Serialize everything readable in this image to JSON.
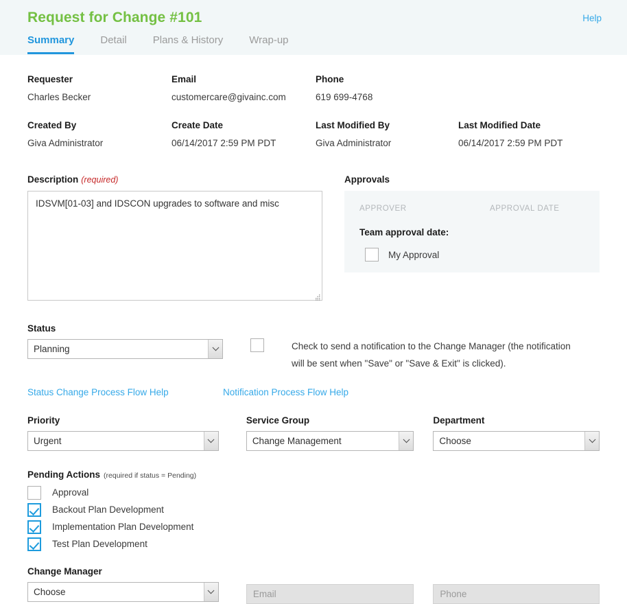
{
  "header": {
    "title": "Request for Change #101",
    "help_label": "Help",
    "tabs": [
      {
        "label": "Summary",
        "active": true
      },
      {
        "label": "Detail",
        "active": false
      },
      {
        "label": "Plans & History",
        "active": false
      },
      {
        "label": "Wrap-up",
        "active": false
      }
    ]
  },
  "info": {
    "requester_label": "Requester",
    "requester_value": "Charles Becker",
    "email_label": "Email",
    "email_value": "customercare@givainc.com",
    "phone_label": "Phone",
    "phone_value": "619 699-4768",
    "created_by_label": "Created By",
    "created_by_value": "Giva Administrator",
    "create_date_label": "Create Date",
    "create_date_value": "06/14/2017 2:59 PM PDT",
    "last_modified_by_label": "Last Modified By",
    "last_modified_by_value": "Giva Administrator",
    "last_modified_date_label": "Last Modified Date",
    "last_modified_date_value": "06/14/2017 2:59 PM PDT"
  },
  "description": {
    "label": "Description",
    "required_flag": "(required)",
    "value": "IDSVM[01-03] and IDSCON upgrades to software and misc"
  },
  "approvals": {
    "label": "Approvals",
    "col_approver": "APPROVER",
    "col_approval_date": "APPROVAL DATE",
    "team_approval_label": "Team approval date:",
    "my_approval_label": "My Approval",
    "my_approval_checked": false
  },
  "status": {
    "label": "Status",
    "value": "Planning",
    "options": [
      "Planning"
    ],
    "flow_help_label": "Status Change Process Flow Help"
  },
  "notification": {
    "checked": false,
    "text_line1": "Check to send a notification to the Change Manager (the notification",
    "text_line2": "will be sent when \"Save\" or \"Save & Exit\" is clicked).",
    "flow_help_label": "Notification Process Flow Help"
  },
  "priority": {
    "label": "Priority",
    "value": "Urgent",
    "options": [
      "Urgent"
    ]
  },
  "service_group": {
    "label": "Service Group",
    "value": "Change Management",
    "options": [
      "Change Management"
    ]
  },
  "department": {
    "label": "Department",
    "value": "Choose",
    "options": [
      "Choose"
    ]
  },
  "pending_actions": {
    "label": "Pending Actions",
    "note": "(required if status = Pending)",
    "items": [
      {
        "label": "Approval",
        "checked": false
      },
      {
        "label": "Backout Plan Development",
        "checked": true
      },
      {
        "label": "Implementation Plan Development",
        "checked": true
      },
      {
        "label": "Test Plan Development",
        "checked": true
      }
    ]
  },
  "change_manager": {
    "label": "Change Manager",
    "value": "Choose",
    "options": [
      "Choose"
    ],
    "email_placeholder": "Email",
    "phone_placeholder": "Phone"
  },
  "colors": {
    "title_green": "#74c043",
    "accent_blue": "#2196dd",
    "link_blue": "#36a9e8",
    "required_red": "#c62828",
    "header_bg": "#f2f7f8",
    "panel_bg": "#f4f7f8",
    "disabled_bg": "#e2e2e2"
  }
}
